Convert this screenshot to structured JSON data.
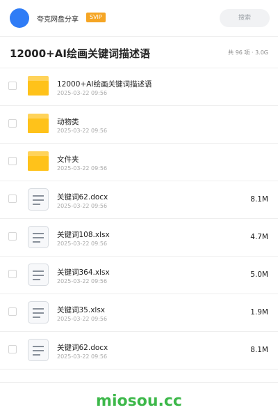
{
  "header": {
    "brand": "夸克网盘分享",
    "badge": "SVIP",
    "search_label": "搜索"
  },
  "titlebar": {
    "title": "12000+AI绘画关键词描述语",
    "summary": "共 96 项 · 3.0G"
  },
  "files": [
    {
      "type": "folder",
      "icon": "folder-icon",
      "name": "12000+AI绘画关键词描述语",
      "date": "2025-03-22 09:56",
      "size": ""
    },
    {
      "type": "folder",
      "icon": "folder-icon",
      "name": "动物类",
      "date": "2025-03-22 09:56",
      "size": ""
    },
    {
      "type": "folder",
      "icon": "folder-icon",
      "name": "文件夹",
      "date": "2025-03-22 09:56",
      "size": ""
    },
    {
      "type": "doc",
      "icon": "document-icon",
      "name": "关键词62.docx",
      "date": "2025-03-22 09:56",
      "size": "8.1M"
    },
    {
      "type": "doc",
      "icon": "document-icon",
      "name": "关键词108.xlsx",
      "date": "2025-03-22 09:56",
      "size": "4.7M"
    },
    {
      "type": "doc",
      "icon": "document-icon",
      "name": "关键词364.xlsx",
      "date": "2025-03-22 09:56",
      "size": "5.0M"
    },
    {
      "type": "doc",
      "icon": "document-icon",
      "name": "关键词35.xlsx",
      "date": "2025-03-22 09:56",
      "size": "1.9M"
    },
    {
      "type": "doc",
      "icon": "document-icon",
      "name": "关键词62.docx",
      "date": "2025-03-22 09:56",
      "size": "8.1M"
    }
  ],
  "footer": {
    "watermark": "miosou.cc"
  },
  "colors": {
    "avatar": "#2f7cf6",
    "badge": "#f5a524",
    "folder": "#ffc21a",
    "watermark": "#3db84a"
  }
}
